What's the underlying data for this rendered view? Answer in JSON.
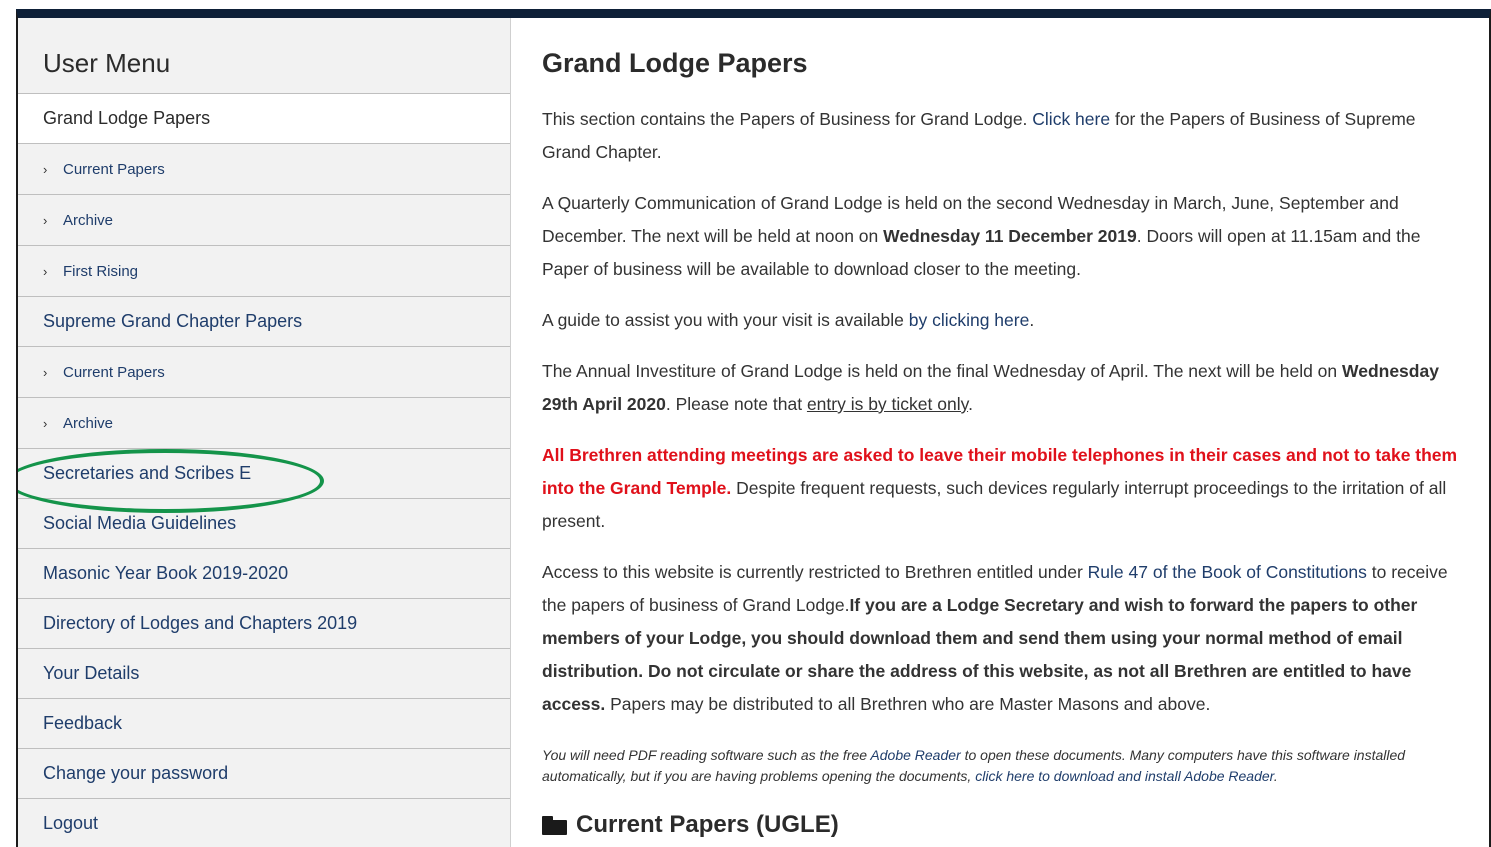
{
  "sidebar": {
    "title": "User Menu",
    "items": [
      {
        "label": "Grand Lodge Papers",
        "type": "main",
        "active": true
      },
      {
        "label": "Current Papers",
        "type": "sub"
      },
      {
        "label": "Archive",
        "type": "sub"
      },
      {
        "label": "First Rising",
        "type": "sub"
      },
      {
        "label": "Supreme Grand Chapter Papers",
        "type": "main"
      },
      {
        "label": "Current Papers",
        "type": "sub"
      },
      {
        "label": "Archive",
        "type": "sub"
      },
      {
        "label": "Secretaries and Scribes E",
        "type": "main"
      },
      {
        "label": "Social Media Guidelines",
        "type": "main"
      },
      {
        "label": "Masonic Year Book 2019-2020",
        "type": "main"
      },
      {
        "label": "Directory of Lodges and Chapters 2019",
        "type": "main"
      },
      {
        "label": "Your Details",
        "type": "main"
      },
      {
        "label": "Feedback",
        "type": "main"
      },
      {
        "label": "Change your password",
        "type": "main"
      },
      {
        "label": "Logout",
        "type": "main"
      }
    ],
    "chevron": "›",
    "highlight_color": "#14944a"
  },
  "main": {
    "title": "Grand Lodge Papers",
    "p1": {
      "a": "This section contains the Papers of Business for Grand Lodge. ",
      "link": "Click here",
      "b": " for the Papers of Business of Supreme Grand Chapter."
    },
    "p2": {
      "a": "A Quarterly Communication of Grand Lodge is held on the second Wednesday in March, June, September and December. The next will be held at noon on ",
      "bold": "Wednesday 11 December 2019",
      "b": ". Doors will open at 11.15am and the Paper of business will be available to download closer to the meeting."
    },
    "p3": {
      "a": "A guide to assist you with your visit is available ",
      "link": "by clicking here",
      "b": "."
    },
    "p4": {
      "a": "The Annual Investiture of Grand Lodge is held on the final Wednesday of April. The next will be held on ",
      "bold": "Wednesday 29th April 2020",
      "b": ". Please note that ",
      "underline": "entry is by ticket only",
      "c": "."
    },
    "p5": {
      "red": "All Brethren attending meetings are asked to leave their mobile telephones in their cases and not to take them into the Grand Temple.",
      "b": " Despite frequent requests, such devices regularly interrupt proceedings to the irritation of all present."
    },
    "p6": {
      "a": "Access to this website is currently restricted to Brethren entitled under ",
      "link": "Rule 47 of the Book of Constitutions",
      "b": " to receive the papers of business of Grand Lodge.",
      "bold": "If you are a Lodge Secretary and wish to forward the papers to other members of your Lodge, you should download them and send them using your normal method of email distribution. Do not circulate or share the address of this website, as not all Brethren are entitled to have access.",
      "c": " Papers may be distributed to all Brethren who are Master Masons and above."
    },
    "note": {
      "a": "You will need PDF reading software such as the free ",
      "link1": "Adobe Reader",
      "b": " to open these documents. Many computers have this software installed automatically, but if you are having problems opening the documents, ",
      "link2": "click here to download and install Adobe Reader",
      "c": "."
    },
    "section_heading": "Current Papers (UGLE)",
    "section_icon": "folder-icon"
  },
  "colors": {
    "link": "#1f3d6b",
    "warning_red": "#e0101a",
    "header_bar": "#0e2038"
  }
}
